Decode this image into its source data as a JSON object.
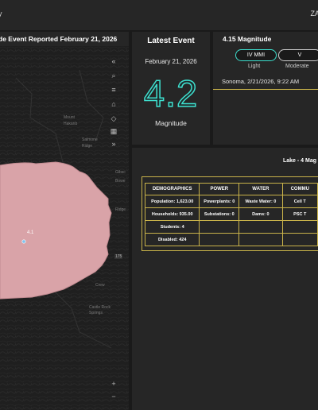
{
  "header": {
    "title": "y",
    "user": "ZA"
  },
  "map": {
    "title": "de Event Reported February 21, 2026",
    "epicenter_label": "4.1",
    "place_labels": [
      "Mount",
      "Hakanb",
      "Salmone",
      "Ridge",
      "Gibsc",
      "Ridge",
      "Crew",
      "Castle Rock",
      "Springs",
      "175",
      "Bowe"
    ],
    "controls": {
      "collapse": "«",
      "search": "⌕",
      "list": "≡",
      "home": "⌂",
      "layers": "◇",
      "grid": "▦",
      "expand": "»",
      "zoom_in": "+",
      "zoom_out": "−"
    }
  },
  "latest": {
    "heading": "Latest Event",
    "date": "February 21, 2026",
    "magnitude": "4.2",
    "magnitude_label": "Magnitude"
  },
  "magnitude_panel": {
    "heading": "4.15 Magnitude",
    "mmi_active": "IV MMI",
    "mmi_active_label": "Light",
    "mmi_next": "V",
    "mmi_next_label": "Moderate",
    "location": "Sonoma, 2/21/2026, 9:22 AM"
  },
  "impact": {
    "title": "Lake - 4 Mag",
    "columns": [
      "DEMOGRAPHICS",
      "POWER",
      "WATER",
      "COMMU"
    ],
    "rows": [
      [
        "Population: 1,623.00",
        "Powerplants: 0",
        "Waste Water: 0",
        "Cell T"
      ],
      [
        "Households: 935.00",
        "Substations: 0",
        "Dams: 0",
        "PSC T"
      ],
      [
        "Students: 4",
        "",
        "",
        ""
      ],
      [
        "Disabled: 424",
        "",
        "",
        ""
      ]
    ]
  },
  "colors": {
    "accent": "#3ee0cf",
    "border": "#c9b34a",
    "shake_area": "#d9a3a8"
  }
}
